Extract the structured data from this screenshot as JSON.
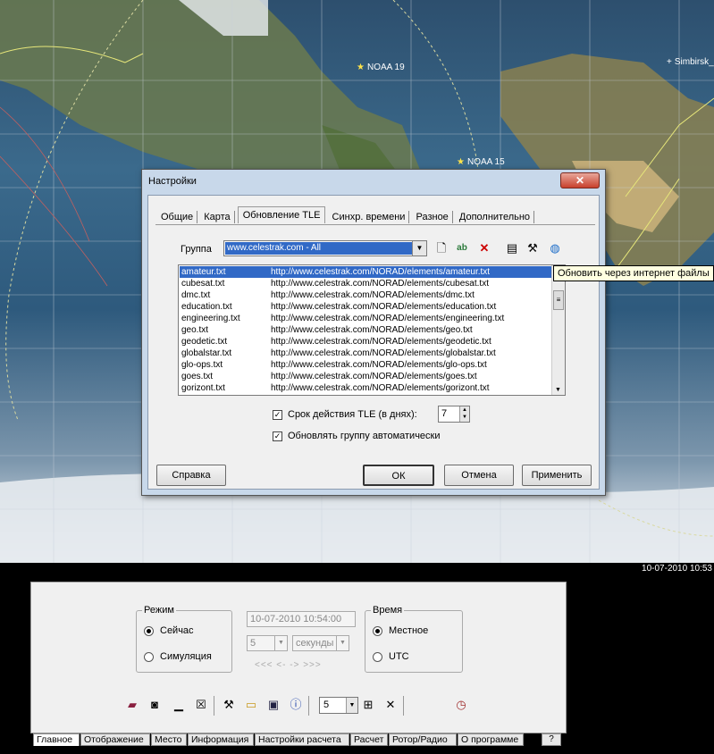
{
  "satellites": [
    {
      "name": "NOAA 19"
    },
    {
      "name": "NOAA 15"
    },
    {
      "name": "Simbirsk_"
    }
  ],
  "clock": "10-07-2010 10:53",
  "dialog": {
    "title": "Настройки",
    "close_label": "✕",
    "tabs": [
      "Общие",
      "Карта",
      "Обновление TLE",
      "Синхр. времени",
      "Разное",
      "Дополнительно"
    ],
    "active_tab": "Обновление TLE",
    "group_label": "Группа",
    "group_value": "www.celestrak.com - All",
    "toolbar_icons": [
      "new-file-icon",
      "rename-icon",
      "delete-icon",
      "list-icon",
      "tools-icon",
      "globe-update-icon"
    ],
    "files": [
      {
        "name": "amateur.txt",
        "url": "http://www.celestrak.com/NORAD/elements/amateur.txt"
      },
      {
        "name": "cubesat.txt",
        "url": "http://www.celestrak.com/NORAD/elements/cubesat.txt"
      },
      {
        "name": "dmc.txt",
        "url": "http://www.celestrak.com/NORAD/elements/dmc.txt"
      },
      {
        "name": "education.txt",
        "url": "http://www.celestrak.com/NORAD/elements/education.txt"
      },
      {
        "name": "engineering.txt",
        "url": "http://www.celestrak.com/NORAD/elements/engineering.txt"
      },
      {
        "name": "geo.txt",
        "url": "http://www.celestrak.com/NORAD/elements/geo.txt"
      },
      {
        "name": "geodetic.txt",
        "url": "http://www.celestrak.com/NORAD/elements/geodetic.txt"
      },
      {
        "name": "globalstar.txt",
        "url": "http://www.celestrak.com/NORAD/elements/globalstar.txt"
      },
      {
        "name": "glo-ops.txt",
        "url": "http://www.celestrak.com/NORAD/elements/glo-ops.txt"
      },
      {
        "name": "goes.txt",
        "url": "http://www.celestrak.com/NORAD/elements/goes.txt"
      },
      {
        "name": "gorizont.txt",
        "url": "http://www.celestrak.com/NORAD/elements/gorizont.txt"
      }
    ],
    "selected_file": "amateur.txt",
    "tle_validity_label": "Срок действия TLE (в днях):",
    "tle_validity_checked": true,
    "tle_validity_days": "7",
    "auto_update_label": "Обновлять группу автоматически",
    "auto_update_checked": true,
    "tooltip": "Обновить через интернет файлы",
    "buttons": {
      "help": "Справка",
      "ok": "ОК",
      "cancel": "Отмена",
      "apply": "Применить"
    }
  },
  "panel": {
    "mode_group": "Режим",
    "mode_now": "Сейчас",
    "mode_sim": "Симуляция",
    "mode_selected": "now",
    "datetime": "10-07-2010 10:54:00",
    "step_value": "5",
    "step_unit": "секунды",
    "nav": "<<<  <-  ->  >>>",
    "time_group": "Время",
    "time_local": "Местное",
    "time_utc": "UTC",
    "time_selected": "local",
    "zoom_value": "5",
    "toolbar_icons": [
      "book-icon",
      "camera-icon",
      "minimize-panel-icon",
      "close-panel-icon",
      "tools-icon",
      "open-folder-icon",
      "save-icon",
      "info-icon",
      "satellite-icon",
      "fit-width-icon",
      "fit-screen-icon",
      "cross-arrows-icon",
      "clock-icon"
    ]
  },
  "bottom_tabs": [
    "Главное",
    "Отображение",
    "Место",
    "Информация",
    "Настройки расчета",
    "Расчет",
    "Ротор/Радио",
    "О программе"
  ],
  "bottom_active_tab": "Главное",
  "help_tab": "?"
}
